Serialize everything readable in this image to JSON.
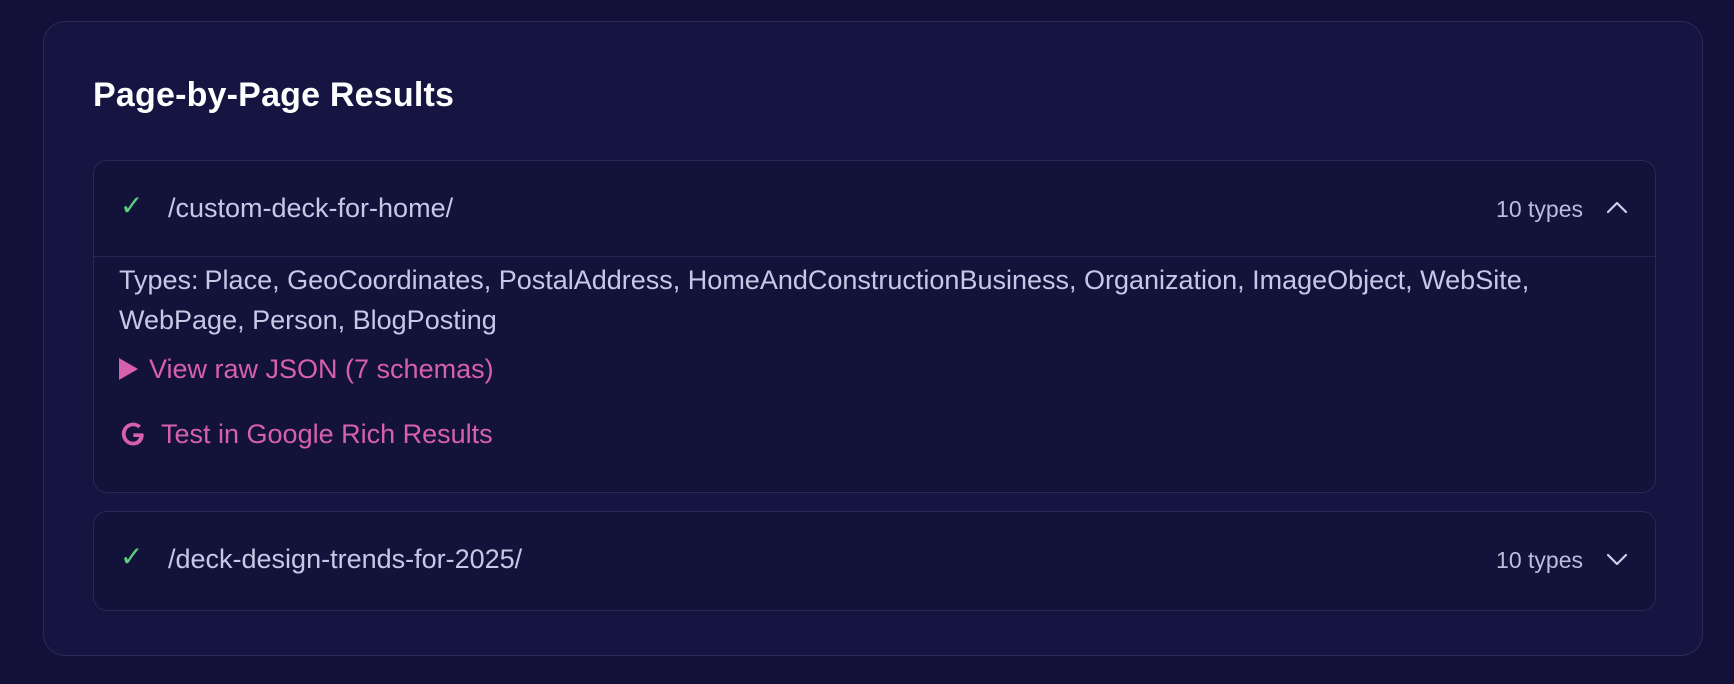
{
  "panel": {
    "title": "Page-by-Page Results"
  },
  "pages": [
    {
      "path": "/custom-deck-for-home/",
      "status_icon": "check-icon",
      "type_count": "10 types",
      "expanded": true,
      "chevron": "chevron-up-icon",
      "types_prefix": "Types:",
      "types_list": "Place, GeoCoordinates, PostalAddress, HomeAndConstructionBusiness, Organization, ImageObject, WebSite, WebPage, Person, BlogPosting",
      "raw_json_label": "View raw JSON (7 schemas)",
      "rich_results_label": "Test in Google Rich Results"
    },
    {
      "path": "/deck-design-trends-for-2025/",
      "status_icon": "check-icon",
      "type_count": "10 types",
      "expanded": false,
      "chevron": "chevron-down-icon"
    }
  ],
  "colors": {
    "background": "#13113a",
    "panel": "#161541",
    "card": "#13123a",
    "success": "#5ad07a",
    "link": "#d760ad",
    "text": "#c7c7e6"
  }
}
